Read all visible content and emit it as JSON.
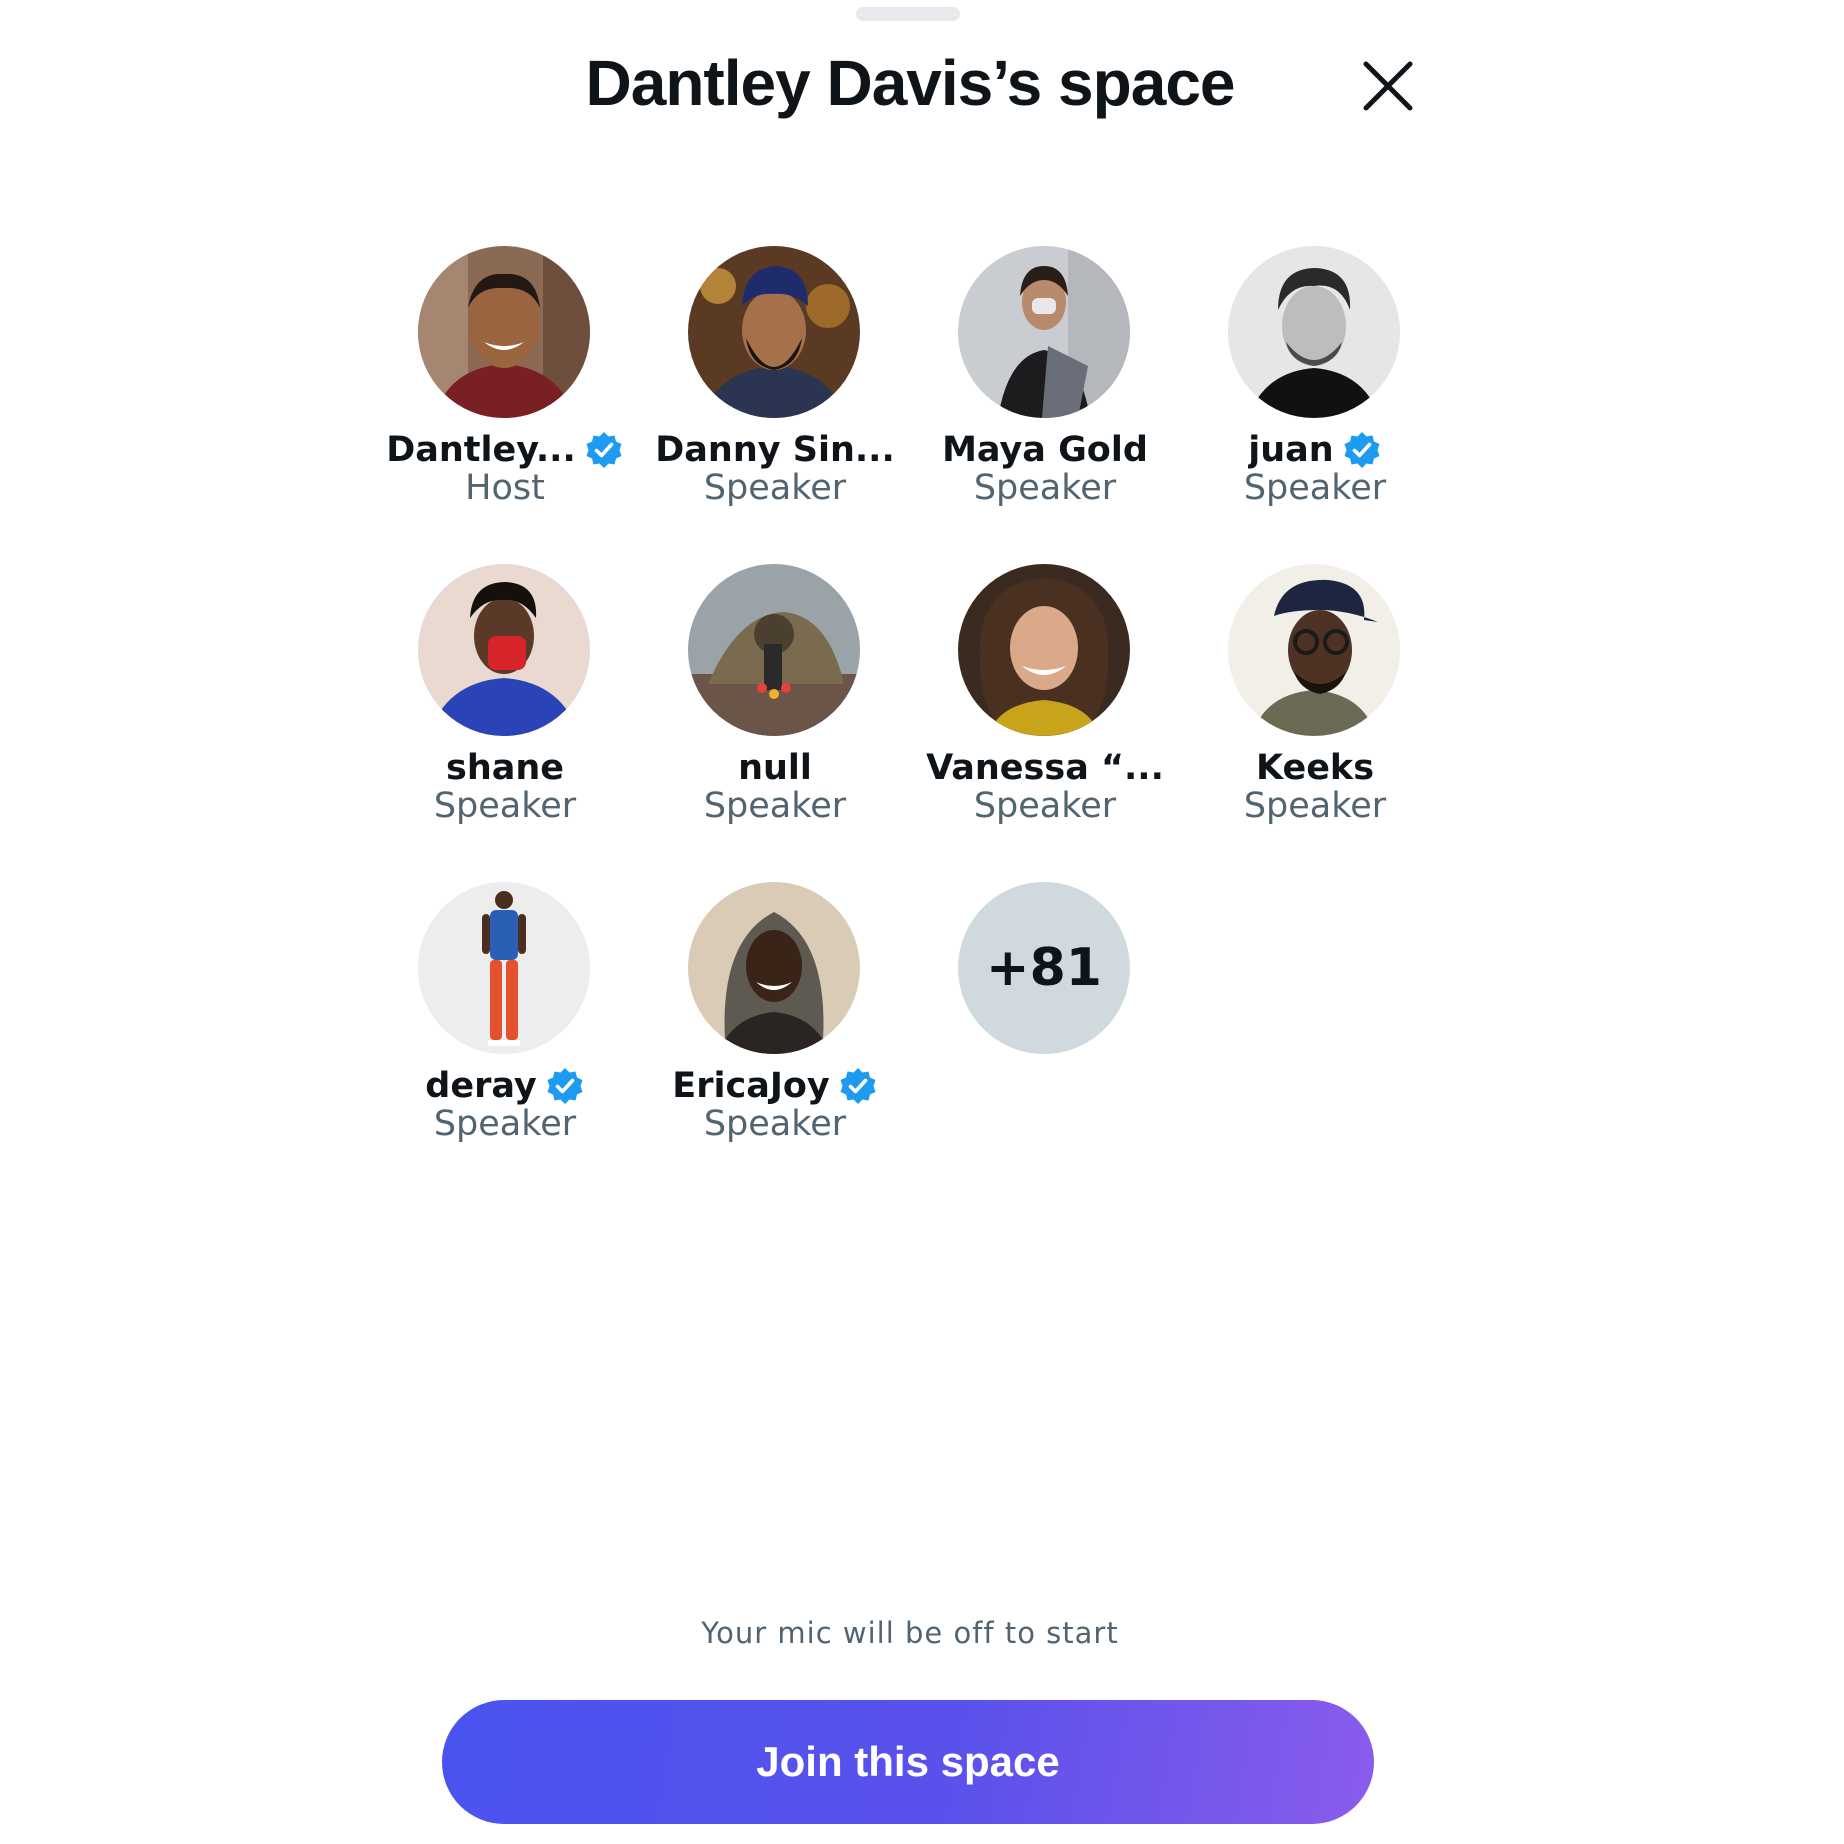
{
  "header": {
    "title": "Dantley Davis’s space"
  },
  "speakers": [
    {
      "name": "Dantley...",
      "role": "Host",
      "verified": true,
      "avatar": "portrait-photo"
    },
    {
      "name": "Danny Sin...",
      "role": "Speaker",
      "verified": false,
      "avatar": "portrait-photo"
    },
    {
      "name": "Maya Gold",
      "role": "Speaker",
      "verified": false,
      "avatar": "portrait-photo"
    },
    {
      "name": "juan",
      "role": "Speaker",
      "verified": true,
      "avatar": "portrait-photo"
    },
    {
      "name": "shane",
      "role": "Speaker",
      "verified": false,
      "avatar": "portrait-photo"
    },
    {
      "name": "null",
      "role": "Speaker",
      "verified": false,
      "avatar": "portrait-photo"
    },
    {
      "name": "Vanessa “...",
      "role": "Speaker",
      "verified": false,
      "avatar": "portrait-photo"
    },
    {
      "name": "Keeks",
      "role": "Speaker",
      "verified": false,
      "avatar": "portrait-photo"
    },
    {
      "name": "deray",
      "role": "Speaker",
      "verified": true,
      "avatar": "portrait-photo"
    },
    {
      "name": "EricaJoy",
      "role": "Speaker",
      "verified": true,
      "avatar": "portrait-photo"
    }
  ],
  "more_count": "+81",
  "mic_note": "Your mic will be off to start",
  "join_button_label": "Join this space",
  "icons": {
    "close": "close-icon",
    "verified": "verified-badge-icon"
  },
  "colors": {
    "verified": "#1d9bf0",
    "button_start": "#4a53ee",
    "button_end": "#8a5cec",
    "secondary_text": "#536471",
    "more_bg": "#cfd9de"
  }
}
